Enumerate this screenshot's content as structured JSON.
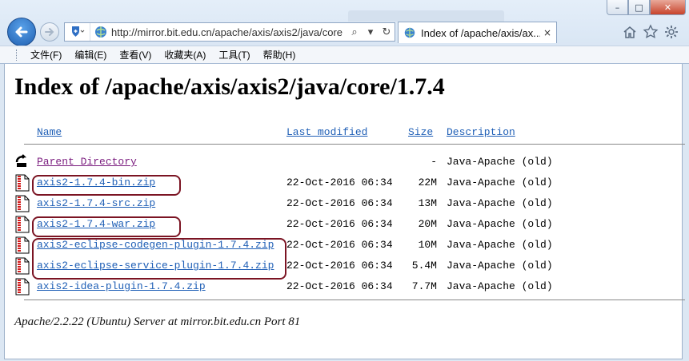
{
  "window": {
    "minimize": "–",
    "maximize": "□",
    "close": "✕"
  },
  "address": {
    "url": "http://mirror.bit.edu.cn/apache/axis/axis2/java/core",
    "search": "⌕",
    "refresh": "↻"
  },
  "tab": {
    "title": "Index of /apache/axis/ax...",
    "close": "×"
  },
  "menu": [
    "文件(F)",
    "编辑(E)",
    "查看(V)",
    "收藏夹(A)",
    "工具(T)",
    "帮助(H)"
  ],
  "page": {
    "heading": "Index of /apache/axis/axis2/java/core/1.7.4",
    "columns": {
      "name": "Name",
      "modified": "Last modified",
      "size": "Size",
      "description": "Description"
    },
    "rows": [
      {
        "name": "Parent Directory",
        "modified": "",
        "size": "-",
        "description": "Java-Apache (old)",
        "icon": "back-folder-icon"
      },
      {
        "name": "axis2-1.7.4-bin.zip",
        "modified": "22-Oct-2016 06:34",
        "size": "22M",
        "description": "Java-Apache (old)",
        "icon": "compressed-file-icon"
      },
      {
        "name": "axis2-1.7.4-src.zip",
        "modified": "22-Oct-2016 06:34",
        "size": "13M",
        "description": "Java-Apache (old)",
        "icon": "compressed-file-icon"
      },
      {
        "name": "axis2-1.7.4-war.zip",
        "modified": "22-Oct-2016 06:34",
        "size": "20M",
        "description": "Java-Apache (old)",
        "icon": "compressed-file-icon"
      },
      {
        "name": "axis2-eclipse-codegen-plugin-1.7.4.zip",
        "modified": "22-Oct-2016 06:34",
        "size": "10M",
        "description": "Java-Apache (old)",
        "icon": "compressed-file-icon"
      },
      {
        "name": "axis2-eclipse-service-plugin-1.7.4.zip",
        "modified": "22-Oct-2016 06:34",
        "size": "5.4M",
        "description": "Java-Apache (old)",
        "icon": "compressed-file-icon"
      },
      {
        "name": "axis2-idea-plugin-1.7.4.zip",
        "modified": "22-Oct-2016 06:34",
        "size": "7.7M",
        "description": "Java-Apache (old)",
        "icon": "compressed-file-icon"
      }
    ],
    "footer": "Apache/2.2.22 (Ubuntu) Server at mirror.bit.edu.cn Port 81"
  },
  "colors": {
    "link": "#1f5fb6",
    "visited": "#7b1d7f",
    "highlight": "#7b1423"
  }
}
